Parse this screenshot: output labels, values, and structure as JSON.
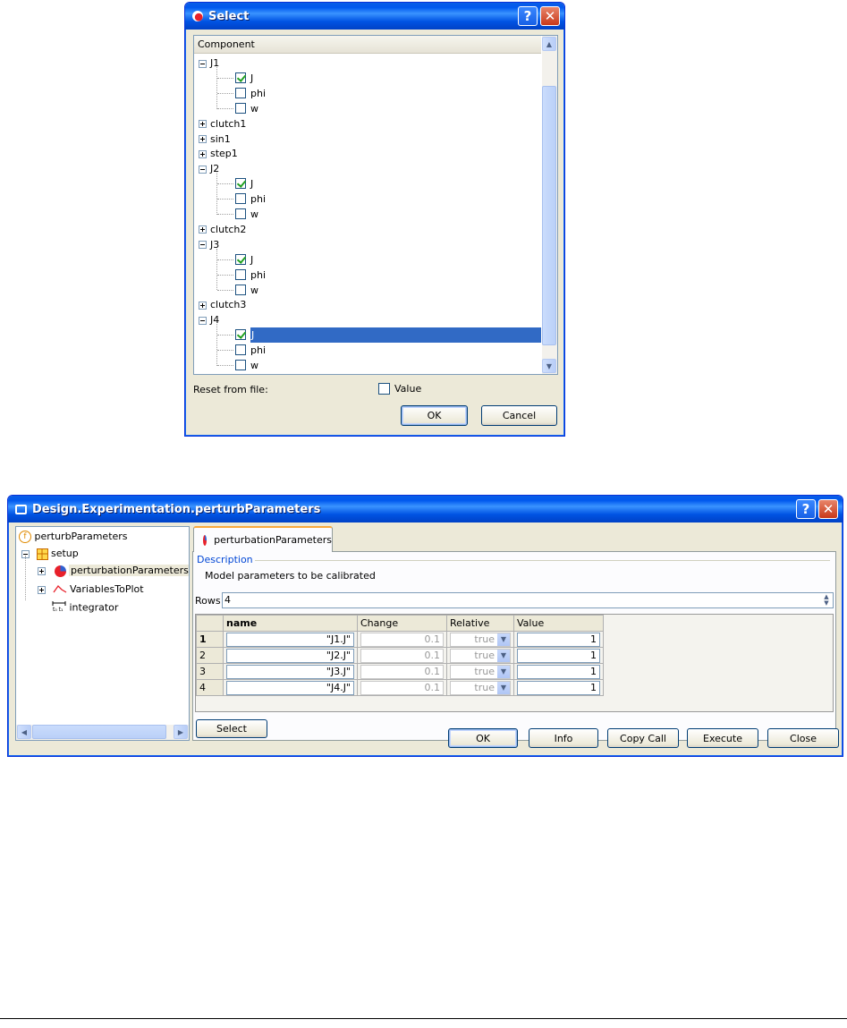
{
  "select_dialog": {
    "title": "Select",
    "help_label": "?",
    "close_label": "✕",
    "column_header": "Component",
    "tree": [
      {
        "label": "J1",
        "expanded": true,
        "children": [
          {
            "label": "J",
            "checked": true
          },
          {
            "label": "phi",
            "checked": false
          },
          {
            "label": "w",
            "checked": false
          }
        ]
      },
      {
        "label": "clutch1",
        "expanded": false
      },
      {
        "label": "sin1",
        "expanded": false
      },
      {
        "label": "step1",
        "expanded": false
      },
      {
        "label": "J2",
        "expanded": true,
        "children": [
          {
            "label": "J",
            "checked": true
          },
          {
            "label": "phi",
            "checked": false
          },
          {
            "label": "w",
            "checked": false
          }
        ]
      },
      {
        "label": "clutch2",
        "expanded": false
      },
      {
        "label": "J3",
        "expanded": true,
        "children": [
          {
            "label": "J",
            "checked": true
          },
          {
            "label": "phi",
            "checked": false
          },
          {
            "label": "w",
            "checked": false
          }
        ]
      },
      {
        "label": "clutch3",
        "expanded": false
      },
      {
        "label": "J4",
        "expanded": true,
        "children": [
          {
            "label": "J",
            "checked": true,
            "selected": true
          },
          {
            "label": "phi",
            "checked": false
          },
          {
            "label": "w",
            "checked": false
          }
        ]
      }
    ],
    "reset_label": "Reset from file:",
    "value_checkbox_label": "Value",
    "value_checked": false,
    "ok_label": "OK",
    "cancel_label": "Cancel"
  },
  "main_dialog": {
    "title": "Design.Experimentation.perturbParameters",
    "help_label": "?",
    "close_label": "✕",
    "tree": {
      "root": "perturbParameters",
      "setup": "setup",
      "children": [
        "perturbationParameters",
        "VariablesToPlot",
        "integrator"
      ]
    },
    "tab_label": "perturbationParameters",
    "description_legend": "Description",
    "description_text": "Model parameters to be calibrated",
    "rows_label": "Rows",
    "rows_value": "4",
    "table": {
      "columns": [
        "name",
        "Change",
        "Relative",
        "Value"
      ],
      "rows": [
        {
          "idx": "1",
          "name": "\"J1.J\"",
          "change": "0.1",
          "relative": "true",
          "value": "1"
        },
        {
          "idx": "2",
          "name": "\"J2.J\"",
          "change": "0.1",
          "relative": "true",
          "value": "1"
        },
        {
          "idx": "3",
          "name": "\"J3.J\"",
          "change": "0.1",
          "relative": "true",
          "value": "1"
        },
        {
          "idx": "4",
          "name": "\"J4.J\"",
          "change": "0.1",
          "relative": "true",
          "value": "1"
        }
      ]
    },
    "select_button": "Select",
    "buttons": [
      "OK",
      "Info",
      "Copy Call",
      "Execute",
      "Close"
    ]
  },
  "colors": {
    "titlebar": "#0058ee",
    "selection": "#316ac5",
    "window_bg": "#ece9d8"
  }
}
